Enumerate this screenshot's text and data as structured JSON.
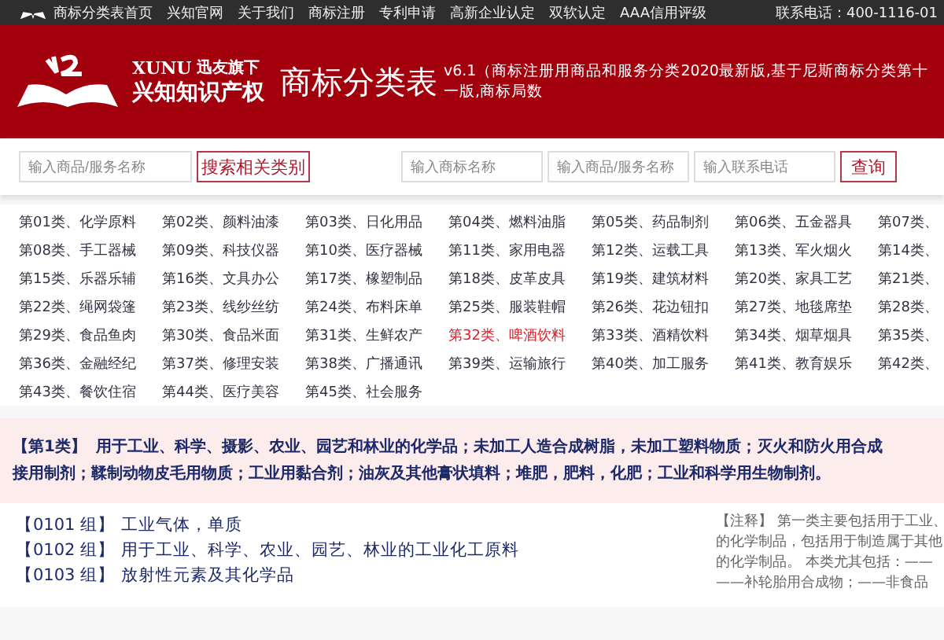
{
  "top_nav": {
    "items": [
      "商标分类表首页",
      "兴知官网",
      "关于我们",
      "商标注册",
      "专利申请",
      "高新企业认定",
      "双软认定",
      "AAA信用评级"
    ],
    "phone": "联系电话：400-1116-01"
  },
  "header": {
    "brand_en": "XUNU",
    "brand_tag": "迅友旗下",
    "brand_cn": "兴知知识产权",
    "title": "商标分类表",
    "subtitle": "v6.1（商标注册用商品和服务分类2020最新版,基于尼斯商标分类第十一版,商标局数"
  },
  "search": {
    "goods_placeholder": "输入商品/服务名称",
    "search_button": "搜索相关类别",
    "trademark_placeholder": "输入商标名称",
    "goods2_placeholder": "输入商品/服务名称",
    "phone_placeholder": "输入联系电话",
    "query_button": "查询"
  },
  "categories": [
    {
      "label": "第01类、化学原料",
      "selected": false
    },
    {
      "label": "第02类、颜料油漆",
      "selected": false
    },
    {
      "label": "第03类、日化用品",
      "selected": false
    },
    {
      "label": "第04类、燃料油脂",
      "selected": false
    },
    {
      "label": "第05类、药品制剂",
      "selected": false
    },
    {
      "label": "第06类、五金器具",
      "selected": false
    },
    {
      "label": "第07类、",
      "selected": false
    },
    {
      "label": "第08类、手工器械",
      "selected": false
    },
    {
      "label": "第09类、科技仪器",
      "selected": false
    },
    {
      "label": "第10类、医疗器械",
      "selected": false
    },
    {
      "label": "第11类、家用电器",
      "selected": false
    },
    {
      "label": "第12类、运载工具",
      "selected": false
    },
    {
      "label": "第13类、军火烟火",
      "selected": false
    },
    {
      "label": "第14类、",
      "selected": false
    },
    {
      "label": "第15类、乐器乐辅",
      "selected": false
    },
    {
      "label": "第16类、文具办公",
      "selected": false
    },
    {
      "label": "第17类、橡塑制品",
      "selected": false
    },
    {
      "label": "第18类、皮革皮具",
      "selected": false
    },
    {
      "label": "第19类、建筑材料",
      "selected": false
    },
    {
      "label": "第20类、家具工艺",
      "selected": false
    },
    {
      "label": "第21类、",
      "selected": false
    },
    {
      "label": "第22类、绳网袋篷",
      "selected": false
    },
    {
      "label": "第23类、线纱丝纺",
      "selected": false
    },
    {
      "label": "第24类、布料床单",
      "selected": false
    },
    {
      "label": "第25类、服装鞋帽",
      "selected": false
    },
    {
      "label": "第26类、花边钮扣",
      "selected": false
    },
    {
      "label": "第27类、地毯席垫",
      "selected": false
    },
    {
      "label": "第28类、",
      "selected": false
    },
    {
      "label": "第29类、食品鱼肉",
      "selected": false
    },
    {
      "label": "第30类、食品米面",
      "selected": false
    },
    {
      "label": "第31类、生鲜农产",
      "selected": false
    },
    {
      "label": "第32类、啤酒饮料",
      "selected": true
    },
    {
      "label": "第33类、酒精饮料",
      "selected": false
    },
    {
      "label": "第34类、烟草烟具",
      "selected": false
    },
    {
      "label": "第35类、",
      "selected": false
    },
    {
      "label": "第36类、金融经纪",
      "selected": false
    },
    {
      "label": "第37类、修理安装",
      "selected": false
    },
    {
      "label": "第38类、广播通讯",
      "selected": false
    },
    {
      "label": "第39类、运输旅行",
      "selected": false
    },
    {
      "label": "第40类、加工服务",
      "selected": false
    },
    {
      "label": "第41类、教育娱乐",
      "selected": false
    },
    {
      "label": "第42类、",
      "selected": false
    },
    {
      "label": "第43类、餐饮住宿",
      "selected": false
    },
    {
      "label": "第44类、医疗美容",
      "selected": false
    },
    {
      "label": "第45类、社会服务",
      "selected": false
    }
  ],
  "class_summary": {
    "heading": "【第1类】",
    "lines": [
      "用于工业、科学、摄影、农业、园艺和林业的化学品；未加工人造合成树脂，未加工塑料物质；灭火和防火用合成",
      "接用制剂；鞣制动物皮毛用物质；工业用黏合剂；油灰及其他膏状填料；堆肥，肥料，化肥；工业和科学用生物制剂。"
    ]
  },
  "groups": [
    {
      "code": "【0101 组】",
      "name": "工业气体，单质"
    },
    {
      "code": "【0102 组】",
      "name": "用于工业、科学、农业、园艺、林业的工业化工原料"
    },
    {
      "code": "【0103 组】",
      "name": "放射性元素及其化学品"
    }
  ],
  "note": {
    "lines": [
      "【注释】 第一类主要包括用于工业、",
      "的化学制品，包括用于制造属于其他",
      "的化学制品。 本类尤其包括：——",
      "——补轮胎用合成物；——非食品"
    ]
  }
}
